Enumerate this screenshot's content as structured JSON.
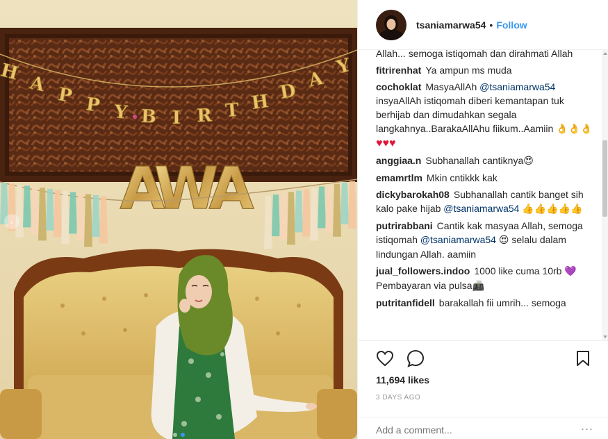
{
  "post": {
    "username": "tsaniamarwa54",
    "separator": "•",
    "follow_label": "Follow",
    "likes": "11,694 likes",
    "time_ago": "3 DAYS AGO",
    "add_comment_placeholder": "Add a comment...",
    "more_label": "..."
  },
  "photo": {
    "banner_letters": [
      "H",
      "A",
      "P",
      "P",
      "Y",
      "B",
      "I",
      "R",
      "T",
      "H",
      "D",
      "A",
      "Y"
    ],
    "balloon_letters": [
      "A",
      "W",
      "A"
    ],
    "carousel_prev": "‹"
  },
  "comments": [
    {
      "id": "c0",
      "user": "",
      "segments": [
        {
          "t": "Allah... semoga istiqomah dan dirahmati Allah"
        }
      ]
    },
    {
      "id": "c1",
      "user": "fitrirenhat",
      "segments": [
        {
          "t": "Ya ampun ms muda"
        }
      ]
    },
    {
      "id": "c2",
      "user": "cochoklat",
      "segments": [
        {
          "t": "MasyaAllAh "
        },
        {
          "t": "@tsaniamarwa54",
          "mention": true
        },
        {
          "t": " insyaAllAh istiqomah diberi kemantapan tuk berhijab dan dimudahkan segala langkahnya..BarakaAllAhu fiikum..Aamiin "
        },
        {
          "t": "👌👌👌",
          "emoji": true
        },
        {
          "t": "♥♥♥",
          "heart": true
        }
      ]
    },
    {
      "id": "c3",
      "user": "anggiaa.n",
      "segments": [
        {
          "t": "Subhanallah cantiknya"
        },
        {
          "t": "😍",
          "emoji": true
        }
      ]
    },
    {
      "id": "c4",
      "user": "emamrtlm",
      "segments": [
        {
          "t": "Mkin cntikkk kak"
        }
      ]
    },
    {
      "id": "c5",
      "user": "dickybarokah08",
      "segments": [
        {
          "t": "Subhanallah cantik banget sih kalo pake hijab "
        },
        {
          "t": "@tsaniamarwa54",
          "mention": true
        },
        {
          "t": " "
        },
        {
          "t": "👍👍👍👍👍",
          "emoji": true
        }
      ]
    },
    {
      "id": "c6",
      "user": "putrirabbani",
      "segments": [
        {
          "t": "Cantik kak masyaa Allah, semoga istiqomah "
        },
        {
          "t": "@tsaniamarwa54",
          "mention": true
        },
        {
          "t": " "
        },
        {
          "t": "😍",
          "emoji": true
        },
        {
          "t": " selalu dalam lindungan Allah. aamiin"
        }
      ]
    },
    {
      "id": "c7",
      "user": "jual_followers.indoo",
      "segments": [
        {
          "t": "1000 like cuma 10rb "
        },
        {
          "t": "💜",
          "emoji": true
        },
        {
          "t": " Pembayaran via pulsa"
        },
        {
          "t": "📠",
          "emoji": true
        }
      ]
    },
    {
      "id": "c8",
      "user": "putritanfidell",
      "segments": [
        {
          "t": "barakallah fii umrih... semoga"
        }
      ]
    }
  ],
  "icons": {
    "like": "heart-outline-icon",
    "comment": "comment-bubble-icon",
    "save": "bookmark-icon"
  },
  "colors": {
    "link_blue": "#3897f0",
    "mention": "#003569",
    "muted": "#999999",
    "text": "#262626",
    "border": "#efefef"
  }
}
